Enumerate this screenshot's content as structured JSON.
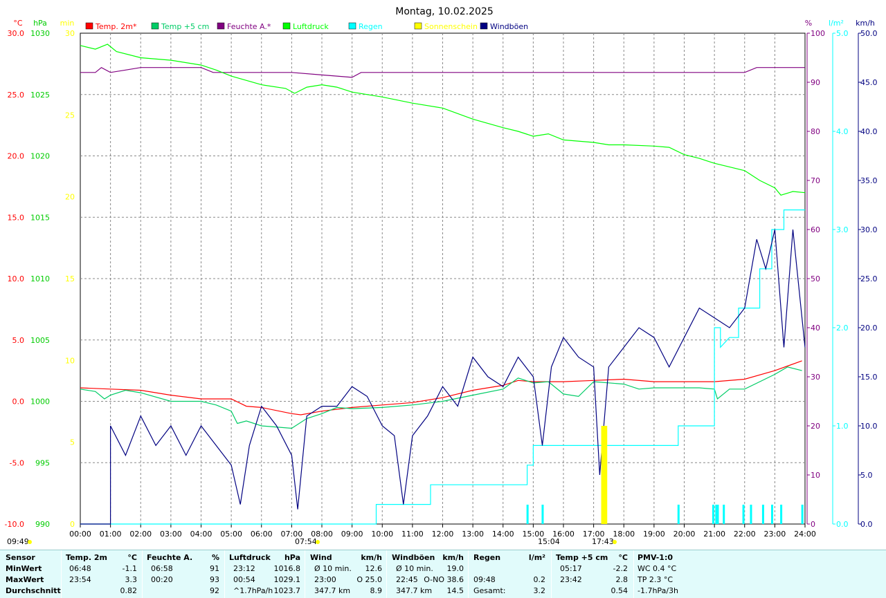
{
  "chart_data": {
    "type": "line",
    "title": "Montag, 10.02.2025",
    "x_range_hours": [
      0,
      24
    ],
    "x_ticks": [
      "00:00",
      "01:00",
      "02:00",
      "03:00",
      "04:00",
      "05:00",
      "06:00",
      "07:00",
      "08:00",
      "09:00",
      "10:00",
      "11:00",
      "12:00",
      "13:00",
      "14:00",
      "15:00",
      "16:00",
      "17:00",
      "18:00",
      "19:00",
      "20:00",
      "21:00",
      "22:00",
      "23:00",
      "24:00"
    ],
    "axes": {
      "temp": {
        "unit": "°C",
        "min": -10,
        "max": 30,
        "ticks": [
          "-10.0",
          "-5.0",
          "0.0",
          "5.0",
          "10.0",
          "15.0",
          "20.0",
          "25.0",
          "30.0"
        ],
        "color": "#ff0000"
      },
      "pressure": {
        "unit": "hPa",
        "min": 990,
        "max": 1030,
        "ticks": [
          "990",
          "995",
          "1000",
          "1005",
          "1010",
          "1015",
          "1020",
          "1025",
          "1030"
        ],
        "color": "#00cc00"
      },
      "sun": {
        "unit": "min",
        "min": 0,
        "max": 30,
        "ticks": [
          "0",
          "5",
          "10",
          "15",
          "20",
          "25",
          "30"
        ],
        "color": "#ffff00"
      },
      "humidity": {
        "unit": "%",
        "min": 0,
        "max": 100,
        "ticks": [
          "0",
          "10",
          "20",
          "30",
          "40",
          "50",
          "60",
          "70",
          "80",
          "90",
          "100"
        ],
        "color": "#800080"
      },
      "rain": {
        "unit": "l/m²",
        "min": 0,
        "max": 5,
        "ticks": [
          "0.0",
          "1.0",
          "2.0",
          "3.0",
          "4.0",
          "5.0"
        ],
        "color": "#00ffff"
      },
      "wind": {
        "unit": "km/h",
        "min": 0,
        "max": 50,
        "ticks": [
          "0.0",
          "5.0",
          "10.0",
          "15.0",
          "20.0",
          "25.0",
          "30.0",
          "35.0",
          "40.0",
          "45.0",
          "50.0"
        ],
        "color": "#000080"
      }
    },
    "legend": [
      {
        "name": "Temp. 2m*",
        "color": "#ff0000"
      },
      {
        "name": "Temp +5 cm",
        "color": "#00cc66"
      },
      {
        "name": "Feuchte A.*",
        "color": "#800080"
      },
      {
        "name": "Luftdruck",
        "color": "#00ff00"
      },
      {
        "name": "Regen",
        "color": "#00ffff"
      },
      {
        "name": "Sonnenschein",
        "color": "#ffff00"
      },
      {
        "name": "Windböen",
        "color": "#000080"
      }
    ],
    "series": [
      {
        "name": "Temp. 2m*",
        "axis": "temp",
        "color": "#ff0000",
        "points": [
          [
            0,
            1.1
          ],
          [
            1,
            1.0
          ],
          [
            2,
            0.9
          ],
          [
            3,
            0.5
          ],
          [
            4,
            0.2
          ],
          [
            5,
            0.2
          ],
          [
            5.5,
            -0.4
          ],
          [
            6,
            -0.5
          ],
          [
            7,
            -1.0
          ],
          [
            7.3,
            -1.1
          ],
          [
            8,
            -0.8
          ],
          [
            9,
            -0.5
          ],
          [
            10,
            -0.3
          ],
          [
            11,
            -0.1
          ],
          [
            12,
            0.3
          ],
          [
            13,
            0.9
          ],
          [
            14,
            1.3
          ],
          [
            14.5,
            1.7
          ],
          [
            15,
            1.6
          ],
          [
            16,
            1.6
          ],
          [
            17,
            1.7
          ],
          [
            18,
            1.8
          ],
          [
            19,
            1.6
          ],
          [
            20,
            1.6
          ],
          [
            21,
            1.6
          ],
          [
            22,
            1.8
          ],
          [
            23,
            2.5
          ],
          [
            23.9,
            3.3
          ]
        ]
      },
      {
        "name": "Temp +5 cm",
        "axis": "temp",
        "color": "#00cc66",
        "points": [
          [
            0,
            1.0
          ],
          [
            0.5,
            0.8
          ],
          [
            0.8,
            0.2
          ],
          [
            1,
            0.5
          ],
          [
            1.5,
            0.9
          ],
          [
            2,
            0.7
          ],
          [
            3,
            0.0
          ],
          [
            4,
            0.0
          ],
          [
            4.5,
            -0.3
          ],
          [
            5,
            -0.8
          ],
          [
            5.2,
            -1.8
          ],
          [
            5.5,
            -1.6
          ],
          [
            6,
            -2.0
          ],
          [
            7,
            -2.2
          ],
          [
            7.5,
            -1.4
          ],
          [
            8,
            -1.0
          ],
          [
            8.5,
            -0.5
          ],
          [
            9,
            -0.6
          ],
          [
            10,
            -0.5
          ],
          [
            11,
            -0.3
          ],
          [
            12,
            0.0
          ],
          [
            13,
            0.5
          ],
          [
            14,
            1.0
          ],
          [
            14.5,
            1.9
          ],
          [
            15,
            1.5
          ],
          [
            15.5,
            1.6
          ],
          [
            16,
            0.6
          ],
          [
            16.5,
            0.4
          ],
          [
            17,
            1.6
          ],
          [
            18,
            1.4
          ],
          [
            18.5,
            1.0
          ],
          [
            19,
            1.1
          ],
          [
            20,
            1.1
          ],
          [
            20.5,
            1.1
          ],
          [
            21,
            1.0
          ],
          [
            21.1,
            0.2
          ],
          [
            21.5,
            1.0
          ],
          [
            22,
            1.0
          ],
          [
            23,
            2.2
          ],
          [
            23.42,
            2.8
          ],
          [
            23.9,
            2.5
          ]
        ]
      },
      {
        "name": "Feuchte A.*",
        "axis": "humidity",
        "color": "#800080",
        "points": [
          [
            0,
            92
          ],
          [
            0.5,
            92
          ],
          [
            0.7,
            93
          ],
          [
            1,
            92
          ],
          [
            1.5,
            92.5
          ],
          [
            2,
            93
          ],
          [
            3,
            93
          ],
          [
            4,
            93
          ],
          [
            4.4,
            92
          ],
          [
            5,
            92
          ],
          [
            6,
            92
          ],
          [
            7,
            92
          ],
          [
            8,
            91.5
          ],
          [
            9,
            91
          ],
          [
            9.3,
            92
          ],
          [
            10,
            92
          ],
          [
            12,
            92
          ],
          [
            14,
            92
          ],
          [
            16,
            92
          ],
          [
            18,
            92
          ],
          [
            20,
            92
          ],
          [
            22,
            92
          ],
          [
            22.4,
            93
          ],
          [
            24,
            93
          ]
        ]
      },
      {
        "name": "Luftdruck",
        "axis": "pressure",
        "color": "#00ff00",
        "points": [
          [
            0,
            1029.0
          ],
          [
            0.5,
            1028.7
          ],
          [
            0.9,
            1029.1
          ],
          [
            1.2,
            1028.5
          ],
          [
            2,
            1028.0
          ],
          [
            3,
            1027.8
          ],
          [
            4,
            1027.4
          ],
          [
            4.5,
            1027.0
          ],
          [
            5,
            1026.5
          ],
          [
            6,
            1025.8
          ],
          [
            6.8,
            1025.5
          ],
          [
            7.1,
            1025.1
          ],
          [
            7.5,
            1025.6
          ],
          [
            8,
            1025.8
          ],
          [
            8.5,
            1025.6
          ],
          [
            9,
            1025.2
          ],
          [
            10,
            1024.8
          ],
          [
            11,
            1024.3
          ],
          [
            12,
            1023.9
          ],
          [
            13,
            1023.0
          ],
          [
            14,
            1022.3
          ],
          [
            14.5,
            1022.0
          ],
          [
            15,
            1021.6
          ],
          [
            15.5,
            1021.8
          ],
          [
            16,
            1021.3
          ],
          [
            17,
            1021.1
          ],
          [
            17.5,
            1020.9
          ],
          [
            18,
            1020.9
          ],
          [
            19,
            1020.8
          ],
          [
            19.5,
            1020.7
          ],
          [
            20,
            1020.1
          ],
          [
            20.5,
            1019.8
          ],
          [
            21,
            1019.4
          ],
          [
            22,
            1018.8
          ],
          [
            22.5,
            1018.0
          ],
          [
            23,
            1017.4
          ],
          [
            23.2,
            1016.8
          ],
          [
            23.6,
            1017.1
          ],
          [
            24,
            1017.0
          ]
        ]
      },
      {
        "name": "Regen",
        "axis": "rain",
        "color": "#00ffff",
        "points": [
          [
            0,
            0
          ],
          [
            9.8,
            0
          ],
          [
            9.8,
            0.2
          ],
          [
            11.6,
            0.2
          ],
          [
            11.6,
            0.4
          ],
          [
            14.8,
            0.4
          ],
          [
            14.8,
            0.6
          ],
          [
            15.0,
            0.6
          ],
          [
            15.0,
            0.8
          ],
          [
            19.8,
            0.8
          ],
          [
            19.8,
            1.0
          ],
          [
            21.0,
            1.0
          ],
          [
            21.0,
            2.0
          ],
          [
            21.2,
            2.0
          ],
          [
            21.2,
            1.8
          ],
          [
            21.5,
            1.9
          ],
          [
            21.8,
            1.9
          ],
          [
            21.8,
            2.2
          ],
          [
            22.5,
            2.2
          ],
          [
            22.5,
            2.6
          ],
          [
            22.9,
            2.6
          ],
          [
            22.9,
            3.0
          ],
          [
            23.3,
            3.0
          ],
          [
            23.3,
            3.2
          ],
          [
            24,
            3.2
          ]
        ]
      },
      {
        "name": "Windböen",
        "axis": "wind",
        "color": "#000080",
        "points": [
          [
            0,
            0
          ],
          [
            1,
            0
          ],
          [
            1,
            10
          ],
          [
            1.5,
            7
          ],
          [
            2,
            11
          ],
          [
            2.5,
            8
          ],
          [
            3,
            10
          ],
          [
            3.5,
            7
          ],
          [
            4,
            10
          ],
          [
            4.5,
            8
          ],
          [
            5,
            6
          ],
          [
            5.3,
            2
          ],
          [
            5.6,
            8
          ],
          [
            6,
            12
          ],
          [
            6.5,
            10
          ],
          [
            7,
            7
          ],
          [
            7.2,
            1.5
          ],
          [
            7.5,
            11
          ],
          [
            8,
            12
          ],
          [
            8.5,
            12
          ],
          [
            9,
            14
          ],
          [
            9.5,
            13
          ],
          [
            10,
            10
          ],
          [
            10.4,
            9
          ],
          [
            10.7,
            2
          ],
          [
            11,
            9
          ],
          [
            11.5,
            11
          ],
          [
            12,
            14
          ],
          [
            12.5,
            12
          ],
          [
            13,
            17
          ],
          [
            13.5,
            15
          ],
          [
            14,
            14
          ],
          [
            14.5,
            17
          ],
          [
            15,
            15
          ],
          [
            15.3,
            8
          ],
          [
            15.6,
            16
          ],
          [
            16,
            19
          ],
          [
            16.5,
            17
          ],
          [
            17,
            16
          ],
          [
            17.2,
            5
          ],
          [
            17.5,
            16
          ],
          [
            18,
            18
          ],
          [
            18.5,
            20
          ],
          [
            19,
            19
          ],
          [
            19.5,
            16
          ],
          [
            20,
            19
          ],
          [
            20.5,
            22
          ],
          [
            21,
            21
          ],
          [
            21.5,
            20
          ],
          [
            22,
            22
          ],
          [
            22.4,
            29
          ],
          [
            22.7,
            26
          ],
          [
            23,
            30
          ],
          [
            23.3,
            18
          ],
          [
            23.6,
            30
          ],
          [
            24,
            18
          ]
        ]
      },
      {
        "name": "Sonnenschein",
        "axis": "sun",
        "color": "#ffff00",
        "points": [
          [
            17.25,
            0
          ],
          [
            17.25,
            6
          ],
          [
            17.45,
            6
          ],
          [
            17.45,
            0
          ]
        ]
      }
    ],
    "rain_marks_hours": [
      14.8,
      15.3,
      19.8,
      20.95,
      21.05,
      21.1,
      21.3,
      21.95,
      22.2,
      22.6,
      22.9,
      23.2,
      23.9
    ],
    "markers": {
      "sunrise": "07:54",
      "noon": "15:04",
      "sunset": "17:43",
      "left_marker": "09:49"
    },
    "grid": true
  },
  "stats": {
    "headers": {
      "sensor": "Sensor",
      "temp": "Temp. 2m",
      "temp_u": "°C",
      "hum": "Feuchte A.",
      "hum_u": "%",
      "press": "Luftdruck",
      "press_u": "hPa",
      "wind": "Wind",
      "wind_u": "km/h",
      "gust": "Windböen",
      "gust_u": "km/h",
      "rain": "Regen",
      "rain_u": "l/m²",
      "t5": "Temp +5 cm",
      "t5_u": "°C",
      "pmv": "PMV-1:0"
    },
    "rows": [
      {
        "label": "MinWert",
        "temp_t": "06:48",
        "temp_v": "-1.1",
        "hum_t": "06:58",
        "hum_v": "91",
        "press_t": "23:12",
        "press_v": "1016.8",
        "wind_t": "Ø 10 min.",
        "wind_v": "12.6",
        "gust_t": "Ø 10 min.",
        "gust_v": "19.0",
        "rain_t": "",
        "rain_v": "",
        "t5_t": "05:17",
        "t5_v": "-2.2",
        "pmv": "WC 0.4 °C"
      },
      {
        "label": "MaxWert",
        "temp_t": "23:54",
        "temp_v": "3.3",
        "hum_t": "00:20",
        "hum_v": "93",
        "press_t": "00:54",
        "press_v": "1029.1",
        "wind_t": "23:00",
        "wind_v": "O 25.0",
        "gust_t": "22:45",
        "gust_v": "O-NO 38.6",
        "rain_t": "09:48",
        "rain_v": "0.2",
        "t5_t": "23:42",
        "t5_v": "2.8",
        "pmv": "TP 2.3 °C"
      },
      {
        "label": "Durchschnitt",
        "temp_t": "",
        "temp_v": "0.82",
        "hum_t": "",
        "hum_v": "92",
        "press_t": "^1.7hPa/h",
        "press_v": "1023.7",
        "wind_t": "347.7 km",
        "wind_v": "8.9",
        "gust_t": "347.7 km",
        "gust_v": "14.5",
        "rain_t": "Gesamt:",
        "rain_v": "3.2",
        "t5_t": "",
        "t5_v": "0.54",
        "pmv": "-1.7hPa/3h"
      }
    ]
  }
}
